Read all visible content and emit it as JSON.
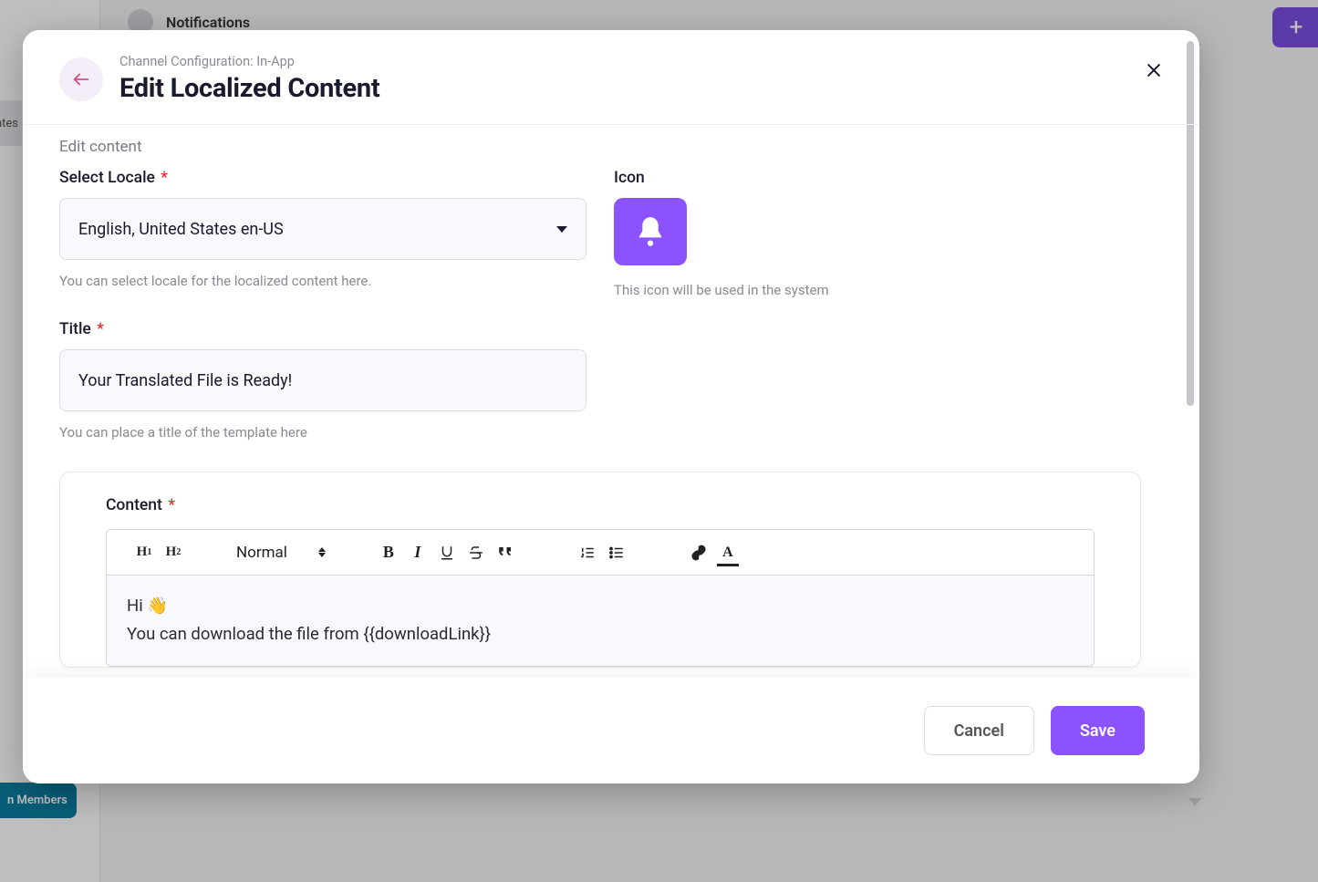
{
  "background": {
    "header_title": "Notifications",
    "left_tab_fragment": "ates",
    "add_button_glyph": "+",
    "members_button_fragment": "n Members"
  },
  "modal": {
    "breadcrumb": "Channel Configuration: In-App",
    "title": "Edit Localized Content",
    "section_label": "Edit content",
    "locale": {
      "label": "Select Locale",
      "value": "English, United States en-US",
      "helper": "You can select locale for the localized content here."
    },
    "icon": {
      "label": "Icon",
      "helper": "This icon will be used in the system"
    },
    "titleField": {
      "label": "Title",
      "value": "Your Translated File is Ready!",
      "helper": "You can place a title of the template here"
    },
    "content": {
      "label": "Content",
      "toolbar": {
        "h1": "H",
        "h1sub": "1",
        "h2": "H",
        "h2sub": "2",
        "normal": "Normal",
        "bold": "B",
        "italic": "I",
        "color": "A"
      },
      "body_line1_prefix": "Hi ",
      "body_line1_emoji": "👋",
      "body_line2": "You can download the file from {{downloadLink}}"
    },
    "footer": {
      "cancel": "Cancel",
      "save": "Save"
    }
  }
}
